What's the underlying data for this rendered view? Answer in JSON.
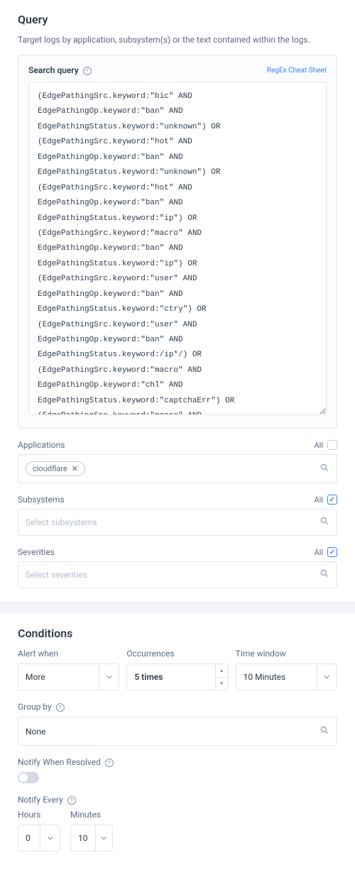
{
  "query": {
    "heading": "Query",
    "subtitle": "Target logs by application, subsystem(s) or the text contained within the logs.",
    "search_label": "Search query",
    "cheat_link": "RegEx Cheat Sheet",
    "search_value": "(EdgePathingSrc.keyword:\"bic\" AND EdgePathingOp.keyword:\"ban\" AND EdgePathingStatus.keyword:\"unknown\") OR (EdgePathingSrc.keyword:\"hot\" AND EdgePathingOp.keyword:\"ban\" AND EdgePathingStatus.keyword:\"unknown\") OR (EdgePathingSrc.keyword:\"hot\" AND EdgePathingOp.keyword:\"ban\" AND EdgePathingStatus.keyword:\"ip\") OR (EdgePathingSrc.keyword:\"macro\" AND EdgePathingOp.keyword:\"ban\" AND EdgePathingStatus.keyword:\"ip\") OR (EdgePathingSrc.keyword:\"user\" AND EdgePathingOp.keyword:\"ban\" AND EdgePathingStatus.keyword:\"ctry\") OR (EdgePathingSrc.keyword:\"user\" AND EdgePathingOp.keyword:\"ban\" AND EdgePathingStatus.keyword:/ip*/) OR (EdgePathingSrc.keyword:\"macro\" AND EdgePathingOp.keyword:\"chl\" AND EdgePathingStatus.keyword:\"captchaErr\") OR (EdgePathingSrc.keyword:\"macro\" AND EdgePathingOp.keyword:\"chl\" AND EdgePathingStatus.keyword:\"captchaFail\") OR (EdgePathingSrc.keyword:\"macro\" AND EdgePathingOp.keyword:\"chl\" AND EdgePathingStatus.keyword:\"captchaNew\") OR (EdgePathingSrc.keyword:\"macro\" AND EdgePathingOp.keyword:\"chl\" AND EdgePathingStatus.keyword:\"jschlFail\") OR (EdgePathingSrc.keyword:\"macro\" AND EdgePathingOp.keyword:\"chl\" AND EdgePathingStatus.keyword:\"jschlNew\") OR (EdgePathingSrc.keyword:\"macro\" AND EdgePathingOp.keyword:\"chl\" AND EdgePathingStatus.keyword:\"jschlErr\") OR (EdgePathingSrc.keyword:\"user\" AND EdgePathingOp.keyword:\"chl\" AND EdgePathingStatus.keyword:\"captchaNew\")"
  },
  "applications": {
    "label": "Applications",
    "all": "All",
    "chip": "cloudflare"
  },
  "subsystems": {
    "label": "Subsystems",
    "all": "All",
    "placeholder": "Select subsystems"
  },
  "severities": {
    "label": "Severities",
    "all": "All",
    "placeholder": "Select severities"
  },
  "conditions": {
    "heading": "Conditions",
    "alert_when": {
      "label": "Alert when",
      "value": "More"
    },
    "occurrences": {
      "label": "Occurrences",
      "value": "5 times"
    },
    "time_window": {
      "label": "Time window",
      "value": "10 Minutes"
    },
    "group_by": {
      "label": "Group by",
      "value": "None"
    },
    "notify_resolved": "Notify When Resolved",
    "notify_every": "Notify Every",
    "hours": {
      "label": "Hours",
      "value": "0"
    },
    "minutes": {
      "label": "Minutes",
      "value": "10"
    }
  }
}
